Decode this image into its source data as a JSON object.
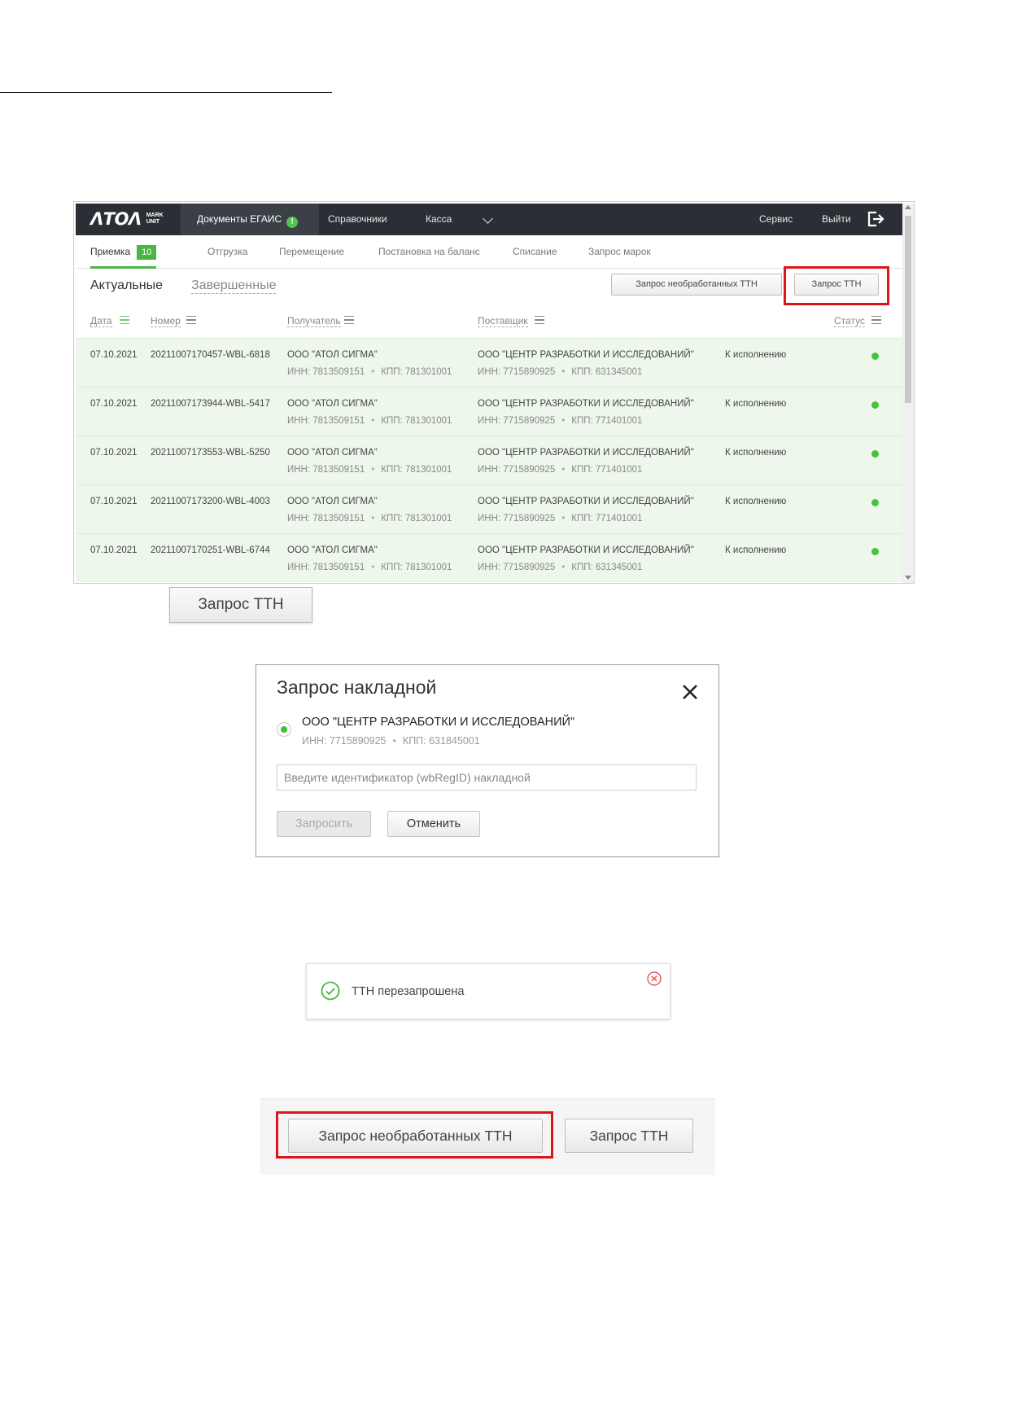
{
  "app": {
    "logo": {
      "main": "ΛΤΟΛ",
      "sub_line1": "MARK",
      "sub_line2": "UNIT"
    },
    "nav": {
      "documents": "Документы ЕГАИС",
      "documents_badge": "!",
      "references": "Справочники",
      "cashbox": "Касса",
      "service": "Сервис",
      "logout": "Выйти"
    },
    "subnav": {
      "receive": "Приемка",
      "receive_count": "10",
      "shipment": "Отгрузка",
      "transfer": "Перемещение",
      "balance": "Постановка на баланс",
      "writeoff": "Списание",
      "marks": "Запрос марок"
    },
    "tabs": {
      "actual": "Актуальные",
      "done": "Завершенные"
    },
    "buttons": {
      "unprocessed": "Запрос необработанных ТТН",
      "tth": "Запрос ТТН"
    },
    "columns": {
      "date": "Дата",
      "number": "Номер",
      "recipient": "Получатель",
      "supplier": "Поставщик",
      "status": "Статус"
    },
    "rows": [
      {
        "date": "07.10.2021",
        "number": "20211007170457-WBL-6818",
        "recipient": "ООО \"АТОЛ СИГМА\"",
        "recipient_inn": "ИНН: 7813509151",
        "recipient_kpp": "КПП: 781301001",
        "supplier": "ООО \"ЦЕНТР РАЗРАБОТКИ И ИССЛЕДОВАНИЙ\"",
        "supplier_inn": "ИНН: 7715890925",
        "supplier_kpp": "КПП: 631345001",
        "status": "К исполнению"
      },
      {
        "date": "07.10.2021",
        "number": "20211007173944-WBL-5417",
        "recipient": "ООО \"АТОЛ СИГМА\"",
        "recipient_inn": "ИНН: 7813509151",
        "recipient_kpp": "КПП: 781301001",
        "supplier": "ООО \"ЦЕНТР РАЗРАБОТКИ И ИССЛЕДОВАНИЙ\"",
        "supplier_inn": "ИНН: 7715890925",
        "supplier_kpp": "КПП: 771401001",
        "status": "К исполнению"
      },
      {
        "date": "07.10.2021",
        "number": "20211007173553-WBL-5250",
        "recipient": "ООО \"АТОЛ СИГМА\"",
        "recipient_inn": "ИНН: 7813509151",
        "recipient_kpp": "КПП: 781301001",
        "supplier": "ООО \"ЦЕНТР РАЗРАБОТКИ И ИССЛЕДОВАНИЙ\"",
        "supplier_inn": "ИНН: 7715890925",
        "supplier_kpp": "КПП: 771401001",
        "status": "К исполнению"
      },
      {
        "date": "07.10.2021",
        "number": "20211007173200-WBL-4003",
        "recipient": "ООО \"АТОЛ СИГМА\"",
        "recipient_inn": "ИНН: 7813509151",
        "recipient_kpp": "КПП: 781301001",
        "supplier": "ООО \"ЦЕНТР РАЗРАБОТКИ И ИССЛЕДОВАНИЙ\"",
        "supplier_inn": "ИНН: 7715890925",
        "supplier_kpp": "КПП: 771401001",
        "status": "К исполнению"
      },
      {
        "date": "07.10.2021",
        "number": "20211007170251-WBL-6744",
        "recipient": "ООО \"АТОЛ СИГМА\"",
        "recipient_inn": "ИНН: 7813509151",
        "recipient_kpp": "КПП: 781301001",
        "supplier": "ООО \"ЦЕНТР РАЗРАБОТКИ И ИССЛЕДОВАНИЙ\"",
        "supplier_inn": "ИНН: 7715890925",
        "supplier_kpp": "КПП: 631345001",
        "status": "К исполнению"
      }
    ]
  },
  "big_button": "Запрос ТТН",
  "modal": {
    "title": "Запрос накладной",
    "supplier": "ООО \"ЦЕНТР РАЗРАБОТКИ И ИССЛЕДОВАНИЙ\"",
    "inn": "ИНН: 7715890925",
    "kpp": "КПП: 631845001",
    "placeholder": "Введите идентификатор (wbRegID) накладной",
    "request": "Запросить",
    "cancel": "Отменить"
  },
  "toast": {
    "message": "ТТН перезапрошена"
  },
  "strip": {
    "unprocessed": "Запрос необработанных ТТН",
    "tth": "Запрос ТТН"
  },
  "colors": {
    "accent_green": "#4bb543",
    "highlight_red": "#e0121b",
    "navbar": "#2b2f35",
    "row_bg": "#eef7ec"
  },
  "icons": {
    "logout": "logout-icon",
    "close": "close-icon",
    "success": "check-circle-icon",
    "dismiss": "close-circle-icon",
    "warning": "warning-badge-icon"
  }
}
